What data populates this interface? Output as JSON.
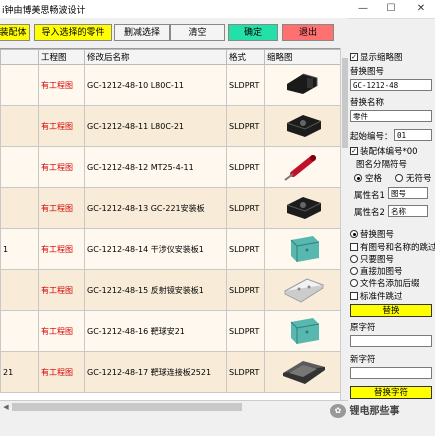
{
  "window": {
    "title": "i钟由博美思畅波设计",
    "minimize": "—",
    "maximize": "☐",
    "close": "✕"
  },
  "toolbar": {
    "buttons": [
      {
        "label": "装配体",
        "color": "#ffff00"
      },
      {
        "label": "导入选择的零件",
        "color": "#ffff00"
      },
      {
        "label": "删减选择",
        "color": "#f4f4f4"
      },
      {
        "label": "清空",
        "color": "#f4f4f4"
      },
      {
        "label": "确定",
        "color": "#22e0a8"
      },
      {
        "label": "退出",
        "color": "#ff7070"
      }
    ]
  },
  "table": {
    "headers": [
      "",
      "工程图",
      "修改后名称",
      "格式",
      "缩略图"
    ],
    "rows": [
      {
        "lead": "",
        "eng": "有工程图",
        "name": "GC-1212-48-10 L80C-11",
        "fmt": "SLDPRT",
        "thumb": "black-bracket-icon"
      },
      {
        "lead": "",
        "eng": "有工程图",
        "name": "GC-1212-48-11 L80C-21",
        "fmt": "SLDPRT",
        "thumb": "black-block-icon"
      },
      {
        "lead": "",
        "eng": "有工程图",
        "name": "GC-1212-48-12 MT25-4-11",
        "fmt": "SLDPRT",
        "thumb": "red-pin-icon"
      },
      {
        "lead": "",
        "eng": "有工程图",
        "name": "GC-1212-48-13 GC-221安装板",
        "fmt": "SLDPRT",
        "thumb": "black-block-icon"
      },
      {
        "lead": "1",
        "eng": "有工程图",
        "name": "GC-1212-48-14 干涉仪安装板1",
        "fmt": "SLDPRT",
        "thumb": "teal-plate-icon"
      },
      {
        "lead": "",
        "eng": "有工程图",
        "name": "GC-1212-48-15 反射镜安装板1",
        "fmt": "SLDPRT",
        "thumb": "white-plate-icon"
      },
      {
        "lead": "",
        "eng": "有工程图",
        "name": "GC-1212-48-16 靶球安21",
        "fmt": "SLDPRT",
        "thumb": "teal-plate-icon"
      },
      {
        "lead": "21",
        "eng": "有工程图",
        "name": "GC-1212-48-17 靶球连接板2521",
        "fmt": "SLDPRT",
        "thumb": "gray-plate-icon"
      }
    ]
  },
  "panel": {
    "show_thumb": "显示缩略图",
    "replace_code_label": "替换图号",
    "replace_code_value": "GC-1212-48",
    "replace_name_label": "替换名称",
    "replace_name_value": "零件",
    "start_no_label": "起始编号：",
    "start_no_value": "01",
    "asm_no": "装配体编号*00",
    "sep_label": "图名分隔符号",
    "sep_space": "空格",
    "sep_none": "无符号",
    "attr1_label": "属性名1",
    "attr1_value": "图号",
    "attr2_label": "属性名2",
    "attr2_value": "名称",
    "opt_replace_code": "替换图号",
    "opt_skip": "有图号和名称的跳过",
    "opt_only_code": "只要图号",
    "opt_add_code": "直接加图号",
    "opt_add_suffix": "文件名添加后缀",
    "opt_skip_std": "标准件跳过",
    "replace_btn": "替换",
    "orig_char_label": "原字符",
    "new_char_label": "新字符",
    "replace_char_btn": "替换字符"
  },
  "watermark": {
    "text": "锂电那些事",
    "icon": "wechat-icon"
  }
}
